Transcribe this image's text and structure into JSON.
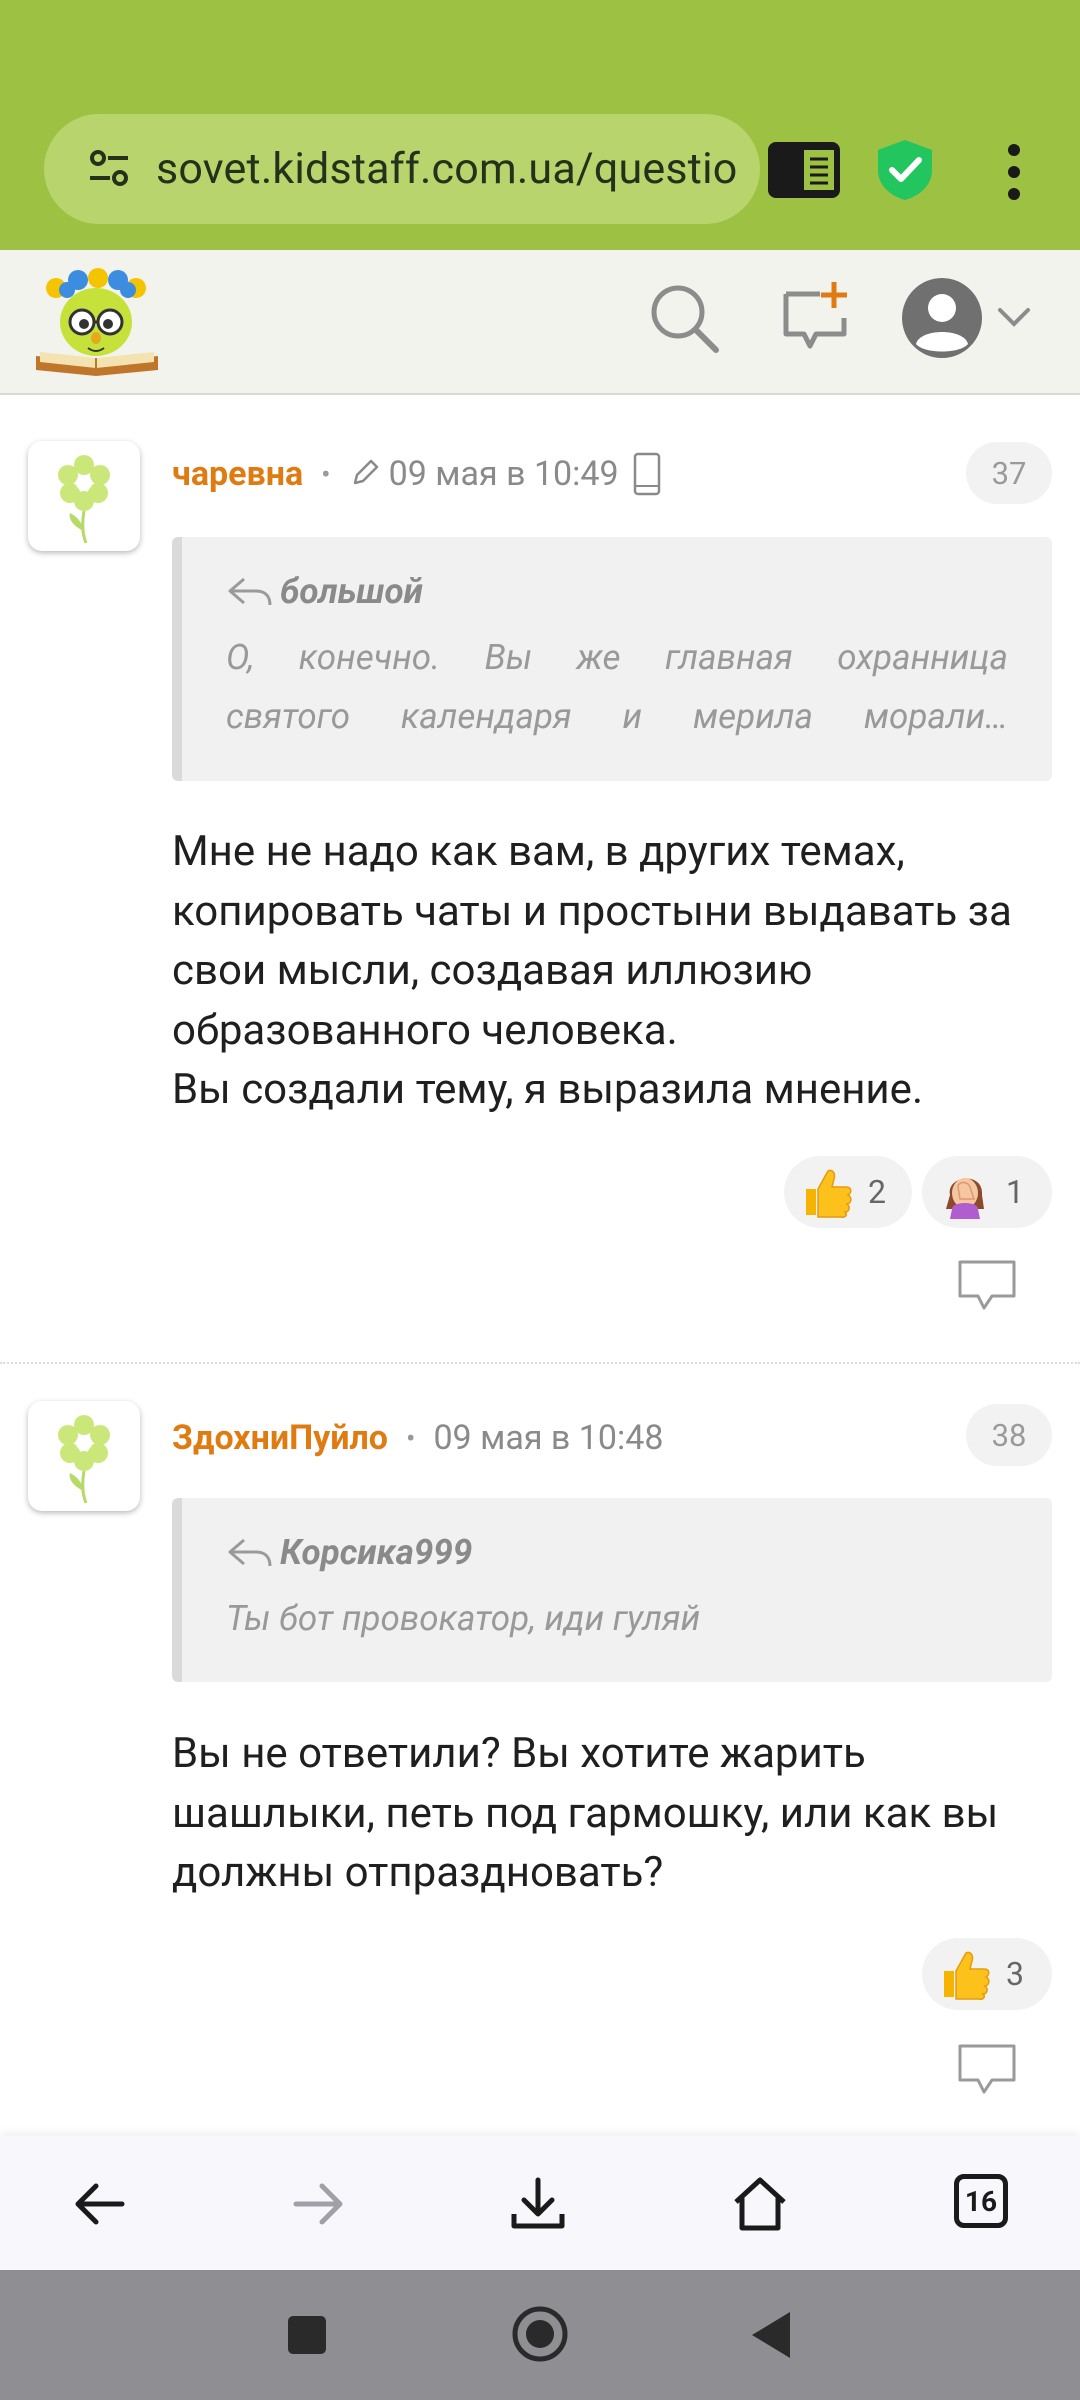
{
  "browser": {
    "url": "sovet.kidstaff.com.ua/questio",
    "tabs_count": "16",
    "colors": {
      "chrome": "#9dc143",
      "url_pill": "#b8d46c",
      "shield": "#22c55e"
    }
  },
  "site": {
    "accent_color": "#e07b12",
    "icons": [
      "logo",
      "search-icon",
      "new-post-icon",
      "user-avatar-icon",
      "chevron-down-icon"
    ]
  },
  "comments": [
    {
      "author": "чаревна",
      "edited": true,
      "date": "09 мая в 10:49",
      "device": "mobile",
      "number": "37",
      "quote_author": "большой",
      "quote_lines": [
        "О, конечно. Вы же главная охранница",
        "святого календаря и мерила морали…"
      ],
      "body_lines": [
        "Мне не надо как вам, в других темах,",
        "копировать чаты и простыни выдавать за",
        "свои мысли, создавая иллюзию",
        "образованного человека.",
        "Вы создали тему, я выразила мнение."
      ],
      "reactions": [
        {
          "emoji": "thumbs-up",
          "count": "2"
        },
        {
          "emoji": "facepalm",
          "count": "1"
        }
      ]
    },
    {
      "author": "ЗдохниПуйло",
      "edited": false,
      "date": "09 мая в 10:48",
      "number": "38",
      "quote_author": "Корсика999",
      "quote_lines": [
        "Ты бот провокатор, иди гуляй"
      ],
      "body_lines": [
        "Вы не ответили? Вы хотите жарить",
        "шашлыки, петь под гармошку, или как вы",
        "должны отпраздновать?"
      ],
      "reactions": [
        {
          "emoji": "thumbs-up",
          "count": "3"
        }
      ]
    }
  ]
}
